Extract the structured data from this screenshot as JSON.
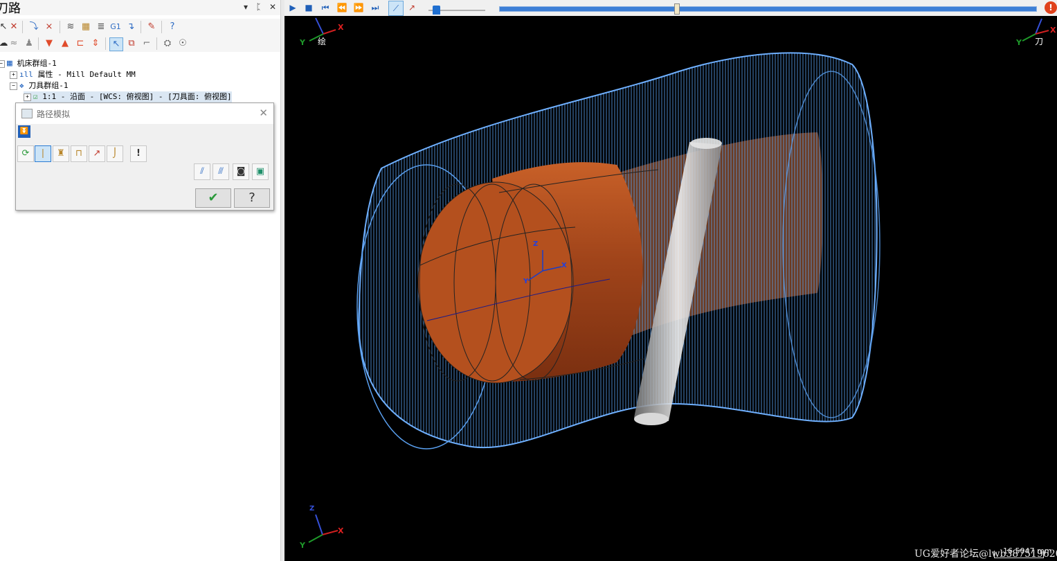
{
  "panel": {
    "title": "刀路",
    "title_controls": [
      "▾",
      "ᛈ",
      "✕"
    ]
  },
  "toolbar1_icons": [
    "select-arrow-icon",
    "delete-x-icon",
    "toolpath-icon",
    "toolpath-delete-icon",
    "layers-icon",
    "stock-icon",
    "layers-settings-icon",
    "g1-icon",
    "post-icon",
    "brush-icon",
    "help-circle-icon"
  ],
  "toolbar1_g1": "G1",
  "toolbar2_icons": [
    "ghost-icon",
    "waves-icon",
    "down-triangle-icon",
    "up-triangle-icon",
    "loop-icon",
    "updown-icon",
    "select-cursor-icon",
    "shape-icon",
    "graph-icon",
    "verify-icon",
    "simulate-icon"
  ],
  "tree": {
    "root": "机床群组-1",
    "properties": "属性 - Mill Default MM",
    "tool_group": "刀具群组-1",
    "operation": "1:1 - 沿面 - [WCS: 俯视图] - [刀具面: 俯视图]"
  },
  "dialog": {
    "title": "路径模拟",
    "close": "✕",
    "row_buttons": [
      "rerun-icon",
      "tool-icon",
      "holder-icon",
      "color-tool-icon",
      "trace-icon",
      "shank-icon",
      "warning-icon"
    ],
    "right_buttons": [
      "step-path-icon",
      "full-path-icon",
      "camera-icon",
      "save-icon"
    ],
    "ok": "✔",
    "help": "?"
  },
  "topbar": {
    "buttons": [
      "play-icon",
      "stop-icon",
      "start-icon",
      "step-back-icon",
      "step-forward-icon",
      "end-icon",
      "trace-mode-icon",
      "show-tool-icon"
    ],
    "speed_fraction": 0.0,
    "progress_fraction": 0.355
  },
  "viewport": {
    "gview_label": "绘",
    "tool_label": "刀",
    "axis_labels": {
      "x": "X",
      "y": "Y",
      "z": "Z"
    },
    "watermark": "UG爱好者论坛@lwb387519620",
    "scale_text": "16.5047 mm"
  },
  "colors": {
    "wire": "#4a90e2",
    "part": "#d46a2e",
    "background": "#000000"
  }
}
